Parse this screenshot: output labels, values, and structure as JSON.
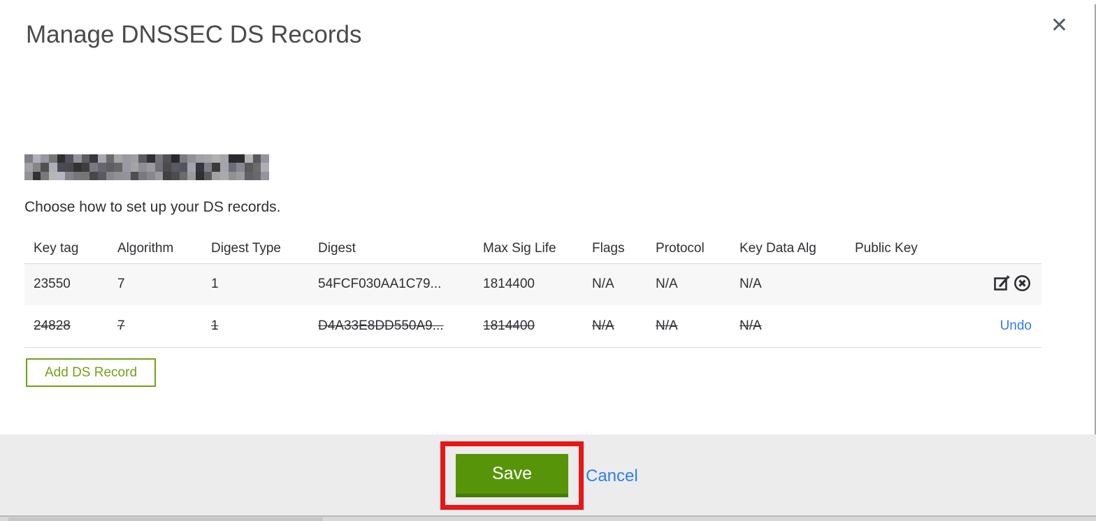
{
  "modal": {
    "title": "Manage DNSSEC DS Records",
    "close_glyph": "✕"
  },
  "intro": {
    "domain_redacted": true,
    "instruction": "Choose how to set up your DS records."
  },
  "table": {
    "columns": [
      "Key tag",
      "Algorithm",
      "Digest Type",
      "Digest",
      "Max Sig Life",
      "Flags",
      "Protocol",
      "Key Data Alg",
      "Public Key"
    ],
    "rows": [
      {
        "key_tag": "23550",
        "algorithm": "7",
        "digest_type": "1",
        "digest": "54FCF030AA1C79...",
        "max_sig_life": "1814400",
        "flags": "N/A",
        "protocol": "N/A",
        "key_data_alg": "N/A",
        "public_key": "",
        "state": "active"
      },
      {
        "key_tag": "24828",
        "algorithm": "7",
        "digest_type": "1",
        "digest": "D4A33E8DD550A9...",
        "max_sig_life": "1814400",
        "flags": "N/A",
        "protocol": "N/A",
        "key_data_alg": "N/A",
        "public_key": "",
        "state": "deleted",
        "undo_label": "Undo"
      }
    ]
  },
  "buttons": {
    "add_ds_record": "Add DS Record",
    "save": "Save",
    "cancel": "Cancel"
  },
  "colors": {
    "save_green": "#58940a",
    "add_button_green": "#71a117",
    "annotation_red": "#e81715",
    "link_blue": "#2f7df2",
    "row_alt_gray": "#f7f7f7",
    "footer_gray": "#ececec"
  }
}
